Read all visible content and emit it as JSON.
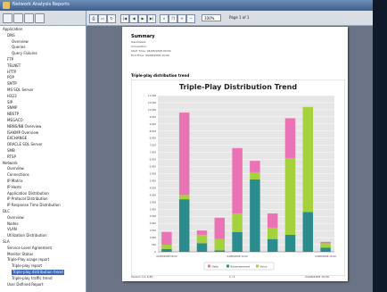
{
  "window": {
    "title": "Network Analysis Reports"
  },
  "tree": {
    "items": [
      {
        "label": "Application"
      },
      {
        "label": "DNS"
      },
      {
        "label": "Overview"
      },
      {
        "label": "Queries"
      },
      {
        "label": "Query Failures"
      },
      {
        "label": "FTP"
      },
      {
        "label": "TELNET"
      },
      {
        "label": "HTTP"
      },
      {
        "label": "POP"
      },
      {
        "label": "SMTP"
      },
      {
        "label": "MS SQL Server"
      },
      {
        "label": "H323"
      },
      {
        "label": "SIP"
      },
      {
        "label": "SNMP"
      },
      {
        "label": "NBSTP"
      },
      {
        "label": "MEGACO"
      },
      {
        "label": "NBNS/NB Overview"
      },
      {
        "label": "ISAKMP Overview"
      },
      {
        "label": "EXCHANGE"
      },
      {
        "label": "ORACLE SQL Server"
      },
      {
        "label": "SMB"
      },
      {
        "label": "RTSP"
      },
      {
        "label": "Network"
      },
      {
        "label": "Overview"
      },
      {
        "label": "Connections"
      },
      {
        "label": "IP Matrix"
      },
      {
        "label": "IP Hosts"
      },
      {
        "label": "Application Distribution"
      },
      {
        "label": "IP Protocol Distribution"
      },
      {
        "label": "IP Response Time Distribution"
      },
      {
        "label": "DLC"
      },
      {
        "label": "Overview"
      },
      {
        "label": "Nodes"
      },
      {
        "label": "VLAN"
      },
      {
        "label": "Utilization Distribution"
      },
      {
        "label": "SLA"
      },
      {
        "label": "Service Level Agreement"
      },
      {
        "label": "Monitor Status"
      },
      {
        "label": "Triple-Play usage report"
      },
      {
        "label": "Triple-play report"
      },
      {
        "label": "Triple-play distribution trend"
      },
      {
        "label": "Triple-play traffic trend"
      },
      {
        "label": "User Defined Report"
      }
    ],
    "selected_index": 40
  },
  "viewer": {
    "zoom": "100%",
    "page_label": "Page 1 of 1",
    "nav": [
      "|◀",
      "◀",
      "▶",
      "▶|"
    ]
  },
  "report": {
    "heading": "Summary",
    "meta": [
      "Generated:",
      "Connection:",
      "Start Time: 04/08/2008 09:00",
      "End Time: 04/08/2008 15:00"
    ],
    "section_title": "Triple-play distribution trend",
    "footer_left": "Version 9.1.0.87",
    "footer_center": "1 / 1",
    "footer_right": "04/08/2008 15:06"
  },
  "colors": {
    "data": "#ea73b5",
    "entertainment": "#2a8c8c",
    "voice": "#a5d13c"
  },
  "chart_data": {
    "type": "bar",
    "title": "Triple-Play Distribution Trend",
    "categories": [
      "04/08/2008 09:00",
      "",
      "",
      "",
      "04/08/2008 12:00",
      "",
      "",
      "",
      "",
      "04/08/2008 15:00"
    ],
    "series": [
      {
        "name": "Data",
        "values": [
          900,
          5800,
          300,
          1500,
          4600,
          800,
          1000,
          2800,
          0,
          100
        ]
      },
      {
        "name": "Entertainment",
        "values": [
          200,
          3700,
          600,
          100,
          1400,
          5100,
          900,
          1200,
          2800,
          300
        ]
      },
      {
        "name": "Voice",
        "values": [
          300,
          300,
          600,
          800,
          1300,
          500,
          800,
          5400,
          7400,
          300
        ]
      }
    ],
    "ylim": [
      0,
      11000
    ],
    "yticks": [
      "0",
      "500",
      "1,000",
      "1,500",
      "2,000",
      "2,500",
      "3,000",
      "3,500",
      "4,000",
      "4,500",
      "5,000",
      "5,500",
      "6,000",
      "6,500",
      "7,000",
      "7,500",
      "8,000",
      "8,500",
      "9,000",
      "9,500",
      "10,000",
      "10,500",
      "11,000"
    ],
    "legend": [
      "Data",
      "Entertainment",
      "Voice"
    ],
    "grid": true,
    "legend_position": "bottom"
  }
}
